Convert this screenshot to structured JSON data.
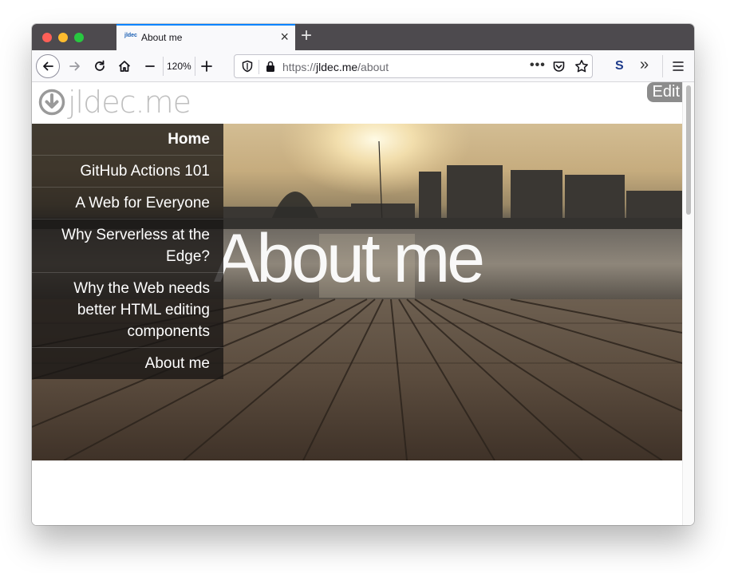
{
  "browser": {
    "tab": {
      "favicon_text": "jldec",
      "title": "About me"
    },
    "zoom_level": "120%",
    "url": {
      "scheme": "https://",
      "host": "jldec.me",
      "path": "/about"
    },
    "extension_label": "S"
  },
  "page": {
    "logo_text": "jldec.me",
    "edit_label": "Edit",
    "hero_title": "About me",
    "nav": [
      {
        "label": "Home",
        "active": true
      },
      {
        "label": "GitHub Actions 101"
      },
      {
        "label": "A Web for Everyone"
      },
      {
        "label": "Why Serverless at the Edge?"
      },
      {
        "label": "Why the Web needs better HTML editing components"
      },
      {
        "label": "About me"
      }
    ]
  },
  "colors": {
    "tab_accent": "#0a84ff",
    "titlebar": "#4d4a4e",
    "edit_button": "#8c8c8c",
    "logo": "#bfbfbf"
  }
}
